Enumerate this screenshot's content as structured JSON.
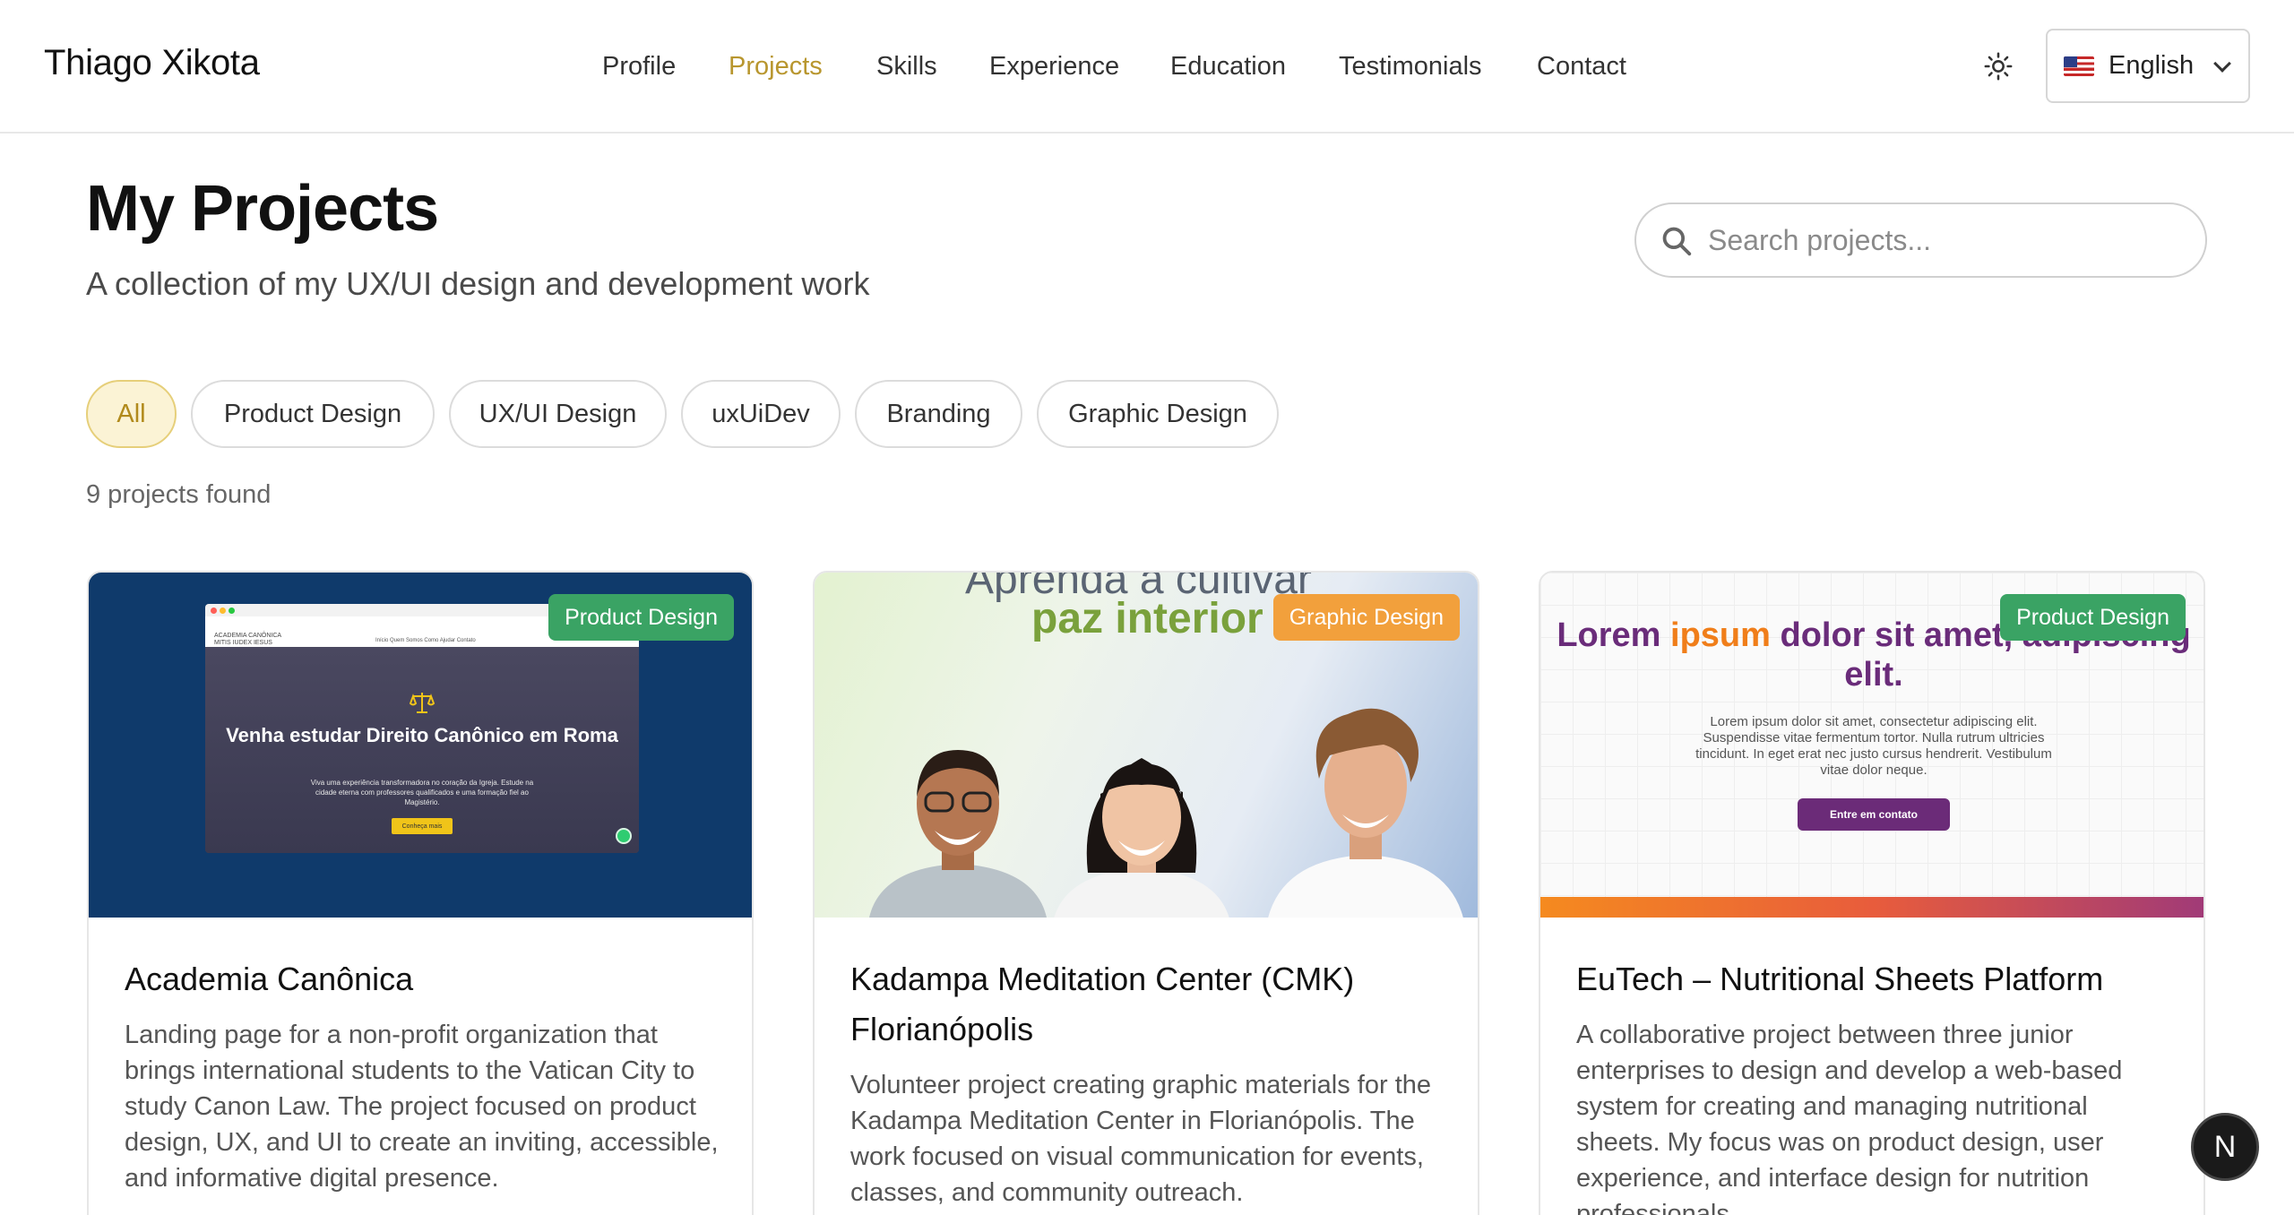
{
  "header": {
    "brand": "Thiago Xikota",
    "nav": [
      {
        "label": "Profile",
        "active": false
      },
      {
        "label": "Projects",
        "active": true
      },
      {
        "label": "Skills",
        "active": false
      },
      {
        "label": "Experience",
        "active": false
      },
      {
        "label": "Education",
        "active": false
      },
      {
        "label": "Testimonials",
        "active": false
      },
      {
        "label": "Contact",
        "active": false
      }
    ],
    "theme_icon": "sun-icon",
    "language": {
      "label": "English",
      "flag": "us-flag-icon"
    }
  },
  "page": {
    "title": "My Projects",
    "subtitle": "A collection of my UX/UI design and development work",
    "search_placeholder": "Search projects...",
    "filters": [
      {
        "label": "All",
        "active": true
      },
      {
        "label": "Product Design",
        "active": false
      },
      {
        "label": "UX/UI Design",
        "active": false
      },
      {
        "label": "uxUiDev",
        "active": false
      },
      {
        "label": "Branding",
        "active": false
      },
      {
        "label": "Graphic Design",
        "active": false
      }
    ],
    "count": "9 projects found"
  },
  "projects": [
    {
      "title": "Academia Canônica",
      "badge": "Product Design",
      "description": "Landing page for a non-profit organization that brings international students to the Vatican City to study Canon Law. The project focused on product design, UX, and UI to create an inviting, accessible, and informative digital presence.",
      "preview": {
        "logo_line1": "ACADEMIA CANÔNICA",
        "logo_line2": "MITIS IUDEX IESUS",
        "nav_links": "Início   Quem Somos   Como Ajudar   Contato",
        "heading": "Venha estudar Direito Canônico em Roma",
        "text": "Viva uma experiência transformadora no coração da Igreja. Estude na cidade eterna com professores qualificados e uma formação fiel ao Magistério.",
        "button": "Conheça mais"
      }
    },
    {
      "title": "Kadampa Meditation Center (CMK) Florianópolis",
      "badge": "Graphic Design",
      "description": "Volunteer project creating graphic materials for the Kadampa Meditation Center in Florianópolis. The work focused on visual communication for events, classes, and community outreach.",
      "preview": {
        "line1": "Aprenda a cultivar",
        "line2": "paz interior"
      }
    },
    {
      "title": "EuTech – Nutritional Sheets Platform",
      "badge": "Product Design",
      "description": "A collaborative project between three junior enterprises to design and develop a web-based system for creating and managing nutritional sheets. My focus was on product design, user experience, and interface design for nutrition professionals.",
      "preview": {
        "h_part1": "Lorem ",
        "h_accent": "ipsum",
        "h_part2": " dolor sit amet, adipiscing elit.",
        "text": "Lorem ipsum dolor sit amet, consectetur adipiscing elit. Suspendisse vitae fermentum tortor. Nulla rutrum ultricies tincidunt. In eget erat nec justo cursus hendrerit. Vestibulum vitae dolor neque.",
        "button": "Entre em contato"
      }
    }
  ],
  "floating_button": "N",
  "colors": {
    "accent": "#b8962e",
    "badge_green": "#3aa364",
    "badge_orange": "#f2a03c"
  }
}
